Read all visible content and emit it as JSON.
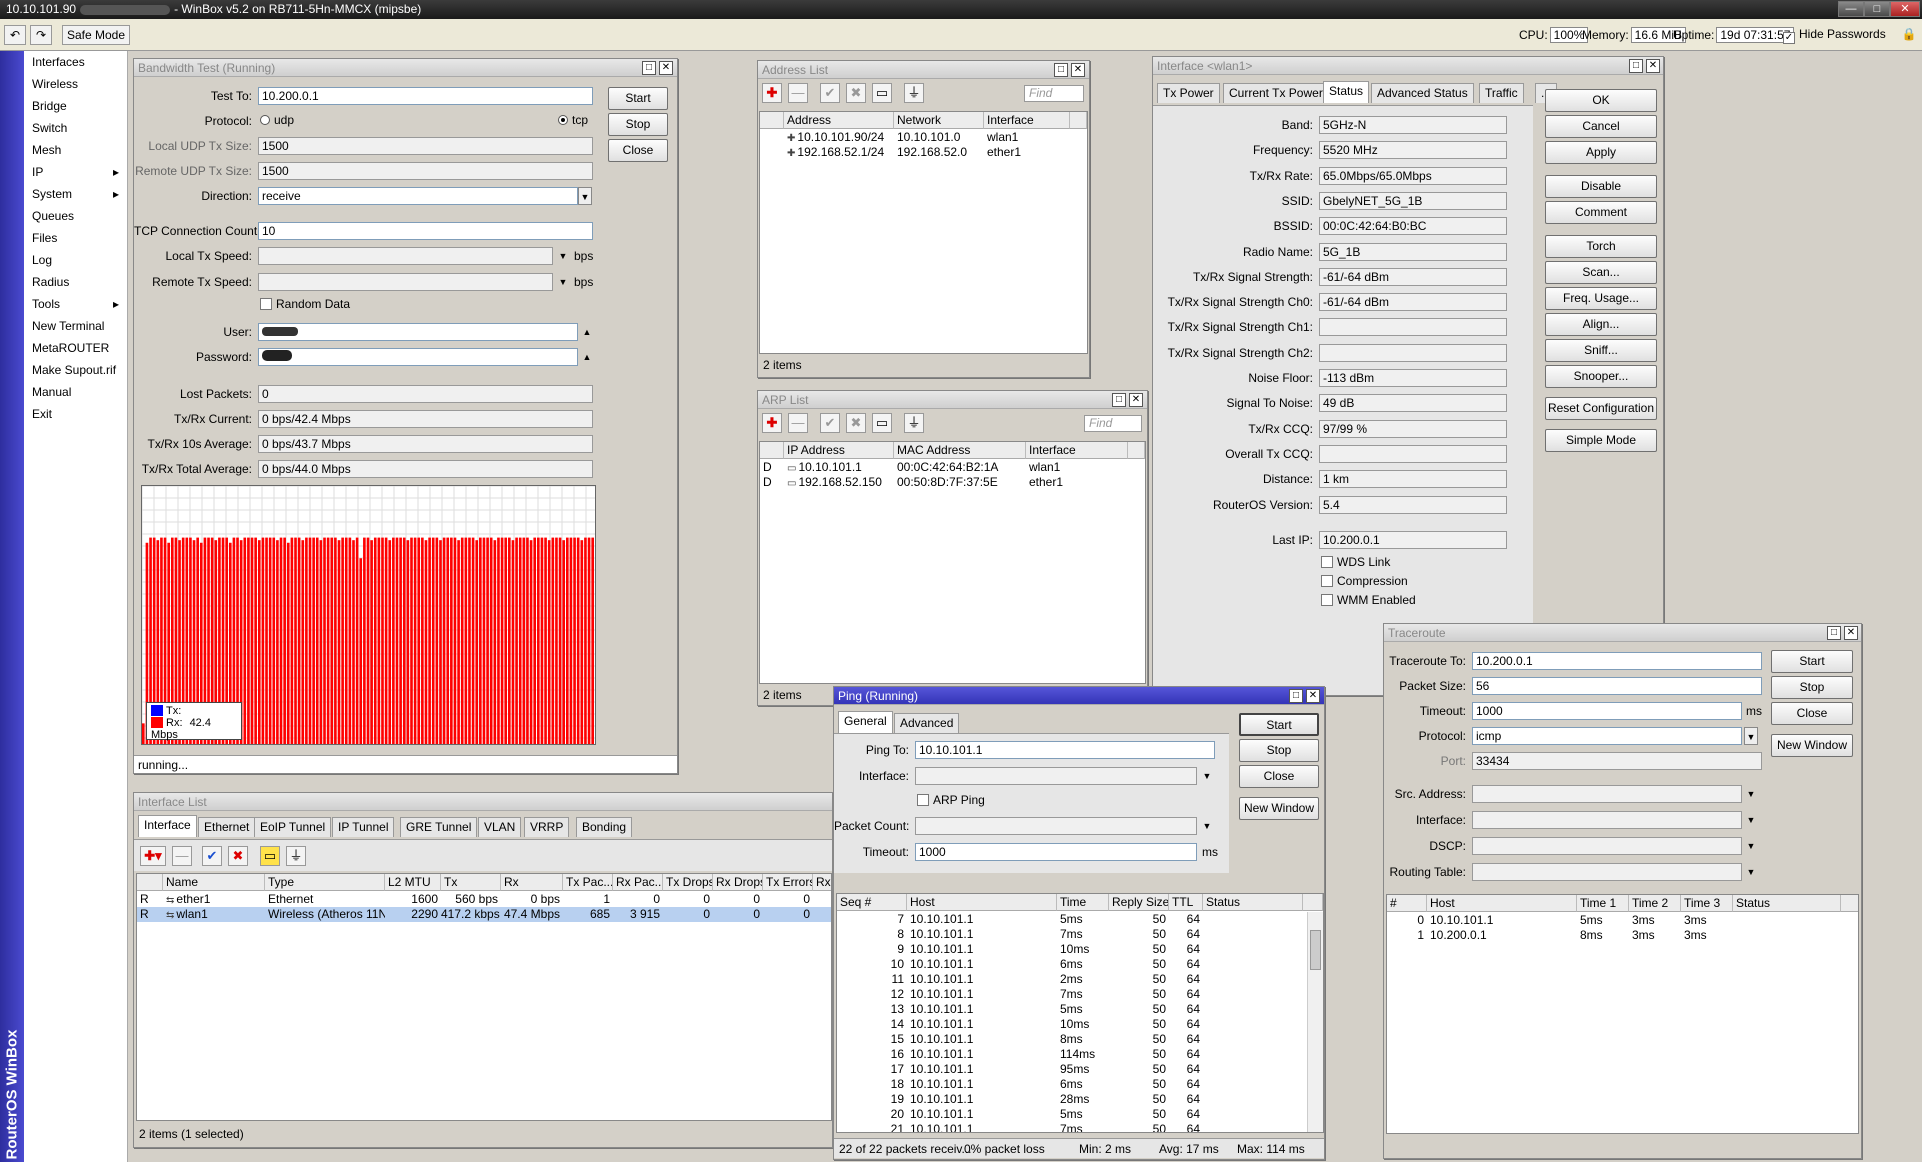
{
  "titlebar": {
    "address": "10.10.101.90",
    "title": "WinBox v5.2 on RB711-5Hn-MMCX (mipsbe)"
  },
  "toolbar": {
    "undo": "↶",
    "redo": "↷",
    "safe_mode": "Safe Mode",
    "cpu_label": "CPU:",
    "cpu": "100%",
    "mem_label": "Memory:",
    "mem": "16.6 MiB",
    "uptime_label": "Uptime:",
    "uptime": "19d 07:31:57",
    "hide_passwords": "Hide Passwords"
  },
  "brand": "RouterOS WinBox",
  "menu": [
    {
      "label": "Interfaces"
    },
    {
      "label": "Wireless"
    },
    {
      "label": "Bridge"
    },
    {
      "label": "Switch"
    },
    {
      "label": "Mesh"
    },
    {
      "label": "IP",
      "arrow": "▸"
    },
    {
      "label": "System",
      "arrow": "▸"
    },
    {
      "label": "Queues"
    },
    {
      "label": "Files"
    },
    {
      "label": "Log"
    },
    {
      "label": "Radius"
    },
    {
      "label": "Tools",
      "arrow": "▸"
    },
    {
      "label": "New Terminal"
    },
    {
      "label": "MetaROUTER"
    },
    {
      "label": "Make Supout.rif"
    },
    {
      "label": "Manual"
    },
    {
      "label": "Exit"
    }
  ],
  "bw": {
    "title": "Bandwidth Test (Running)",
    "test_to_l": "Test To:",
    "test_to": "10.200.0.1",
    "protocol_l": "Protocol:",
    "udp": "udp",
    "tcp": "tcp",
    "ludp_l": "Local UDP Tx Size:",
    "ludp": "1500",
    "rudp_l": "Remote UDP Tx Size:",
    "rudp": "1500",
    "dir_l": "Direction:",
    "dir": "receive",
    "tcpc_l": "TCP Connection Count:",
    "tcpc": "10",
    "ltx_l": "Local Tx Speed:",
    "rtx_l": "Remote Tx Speed:",
    "bps": "bps",
    "random": "Random Data",
    "user_l": "User:",
    "pass_l": "Password:",
    "lost_l": "Lost Packets:",
    "lost": "0",
    "cur_l": "Tx/Rx Current:",
    "cur": "0 bps/42.4 Mbps",
    "avg10_l": "Tx/Rx 10s Average:",
    "avg10": "0 bps/43.7 Mbps",
    "tot_l": "Tx/Rx Total Average:",
    "tot": "0 bps/44.0 Mbps",
    "start": "Start",
    "stop": "Stop",
    "close": "Close",
    "legend_tx": "Tx:",
    "legend_rx": "Rx:",
    "legend_rx_val": "42.4 Mbps",
    "status": "running...",
    "tx_color": "#0000ff",
    "rx_color": "#ff0000"
  },
  "chart_data": {
    "type": "bar",
    "series": [
      {
        "name": "Rx",
        "values": [
          8,
          78,
          80,
          80,
          79,
          80,
          80,
          78,
          80,
          80,
          79,
          80,
          80,
          80,
          79,
          80,
          78,
          80,
          80,
          80,
          79,
          80,
          80,
          80,
          78,
          80,
          80,
          79,
          80,
          80,
          80,
          80,
          79,
          80,
          80,
          80,
          80,
          79,
          80,
          80,
          78,
          80,
          80,
          80,
          79,
          80,
          80,
          80,
          80,
          79,
          80,
          80,
          80,
          80,
          79,
          80,
          80,
          80,
          79,
          80,
          72,
          80,
          80,
          79,
          80,
          80,
          80,
          80,
          79,
          80,
          80,
          80,
          80,
          79,
          80,
          80,
          80,
          80,
          79,
          80,
          80,
          80,
          79,
          80,
          80,
          80,
          80,
          79,
          80,
          80,
          80,
          80,
          79,
          80,
          80,
          80,
          80,
          79,
          80,
          80,
          80,
          80,
          79,
          80,
          80,
          80,
          80,
          79,
          80,
          80,
          80,
          80,
          79,
          80,
          80,
          80,
          79,
          80,
          80,
          80,
          80,
          79,
          80,
          80,
          80
        ]
      }
    ]
  },
  "addr": {
    "title": "Address List",
    "find": "Find",
    "cols": [
      "Address",
      "Network",
      "Interface"
    ],
    "rows": [
      [
        "10.10.101.90/24",
        "10.10.101.0",
        "wlan1"
      ],
      [
        "192.168.52.1/24",
        "192.168.52.0",
        "ether1"
      ]
    ],
    "status": "2 items"
  },
  "arp": {
    "title": "ARP List",
    "find": "Find",
    "cols": [
      "IP Address",
      "MAC Address",
      "Interface"
    ],
    "rows": [
      [
        "D",
        "10.10.101.1",
        "00:0C:42:64:B2:1A",
        "wlan1"
      ],
      [
        "D",
        "192.168.52.150",
        "00:50:8D:7F:37:5E",
        "ether1"
      ]
    ],
    "status": "2 items"
  },
  "iface": {
    "title": "Interface <wlan1>",
    "tabs": [
      "Tx Power",
      "Current Tx Power",
      "Status",
      "Advanced Status",
      "Traffic",
      "..."
    ],
    "fields": [
      [
        "Band:",
        "5GHz-N"
      ],
      [
        "Frequency:",
        "5520 MHz"
      ],
      [
        "Tx/Rx Rate:",
        "65.0Mbps/65.0Mbps"
      ],
      [
        "SSID:",
        "GbelyNET_5G_1B"
      ],
      [
        "BSSID:",
        "00:0C:42:64:B0:BC"
      ],
      [
        "Radio Name:",
        "5G_1B"
      ],
      [
        "Tx/Rx Signal Strength:",
        "-61/-64 dBm"
      ],
      [
        "Tx/Rx Signal Strength Ch0:",
        "-61/-64 dBm"
      ],
      [
        "Tx/Rx Signal Strength Ch1:",
        ""
      ],
      [
        "Tx/Rx Signal Strength Ch2:",
        ""
      ],
      [
        "Noise Floor:",
        "-113 dBm"
      ],
      [
        "Signal To Noise:",
        "49 dB"
      ],
      [
        "Tx/Rx CCQ:",
        "97/99 %"
      ],
      [
        "Overall Tx CCQ:",
        ""
      ],
      [
        "Distance:",
        "1 km"
      ],
      [
        "RouterOS Version:",
        "5.4"
      ]
    ],
    "last_ip_l": "Last IP:",
    "last_ip": "10.200.0.1",
    "wds": "WDS Link",
    "compression": "Compression",
    "wmm": "WMM Enabled",
    "buttons": [
      "OK",
      "Cancel",
      "Apply",
      "Disable",
      "Comment",
      "Torch",
      "Scan...",
      "Freq. Usage...",
      "Align...",
      "Sniff...",
      "Snooper...",
      "Reset Configuration",
      "Simple Mode"
    ]
  },
  "ilist": {
    "title": "Interface List",
    "tabs": [
      "Interface",
      "Ethernet",
      "EoIP Tunnel",
      "IP Tunnel",
      "GRE Tunnel",
      "VLAN",
      "VRRP",
      "Bonding"
    ],
    "cols": [
      "Name",
      "Type",
      "L2 MTU",
      "Tx",
      "Rx",
      "Tx Pac...",
      "Rx Pac...",
      "Tx Drops",
      "Rx Drops",
      "Tx Errors",
      "Rx Er"
    ],
    "rows": [
      [
        "R",
        "ether1",
        "Ethernet",
        "1600",
        "560 bps",
        "0 bps",
        "1",
        "0",
        "0",
        "0",
        "0"
      ],
      [
        "R",
        "wlan1",
        "Wireless (Atheros 11N)",
        "2290",
        "417.2 kbps",
        "47.4 Mbps",
        "685",
        "3 915",
        "0",
        "0",
        "0"
      ]
    ],
    "status": "2 items (1 selected)"
  },
  "ping": {
    "title": "Ping (Running)",
    "tabs": [
      "General",
      "Advanced"
    ],
    "ping_to_l": "Ping To:",
    "ping_to": "10.10.101.1",
    "iface_l": "Interface:",
    "arp": "ARP Ping",
    "pc_l": "Packet Count:",
    "timeout_l": "Timeout:",
    "timeout": "1000",
    "ms": "ms",
    "start": "Start",
    "stop": "Stop",
    "close": "Close",
    "new_window": "New Window",
    "cols": [
      "Seq #",
      "Host",
      "Time",
      "Reply Size",
      "TTL",
      "Status"
    ],
    "rows": [
      [
        "7",
        "10.10.101.1",
        "5ms",
        "50",
        "64"
      ],
      [
        "8",
        "10.10.101.1",
        "7ms",
        "50",
        "64"
      ],
      [
        "9",
        "10.10.101.1",
        "10ms",
        "50",
        "64"
      ],
      [
        "10",
        "10.10.101.1",
        "6ms",
        "50",
        "64"
      ],
      [
        "11",
        "10.10.101.1",
        "2ms",
        "50",
        "64"
      ],
      [
        "12",
        "10.10.101.1",
        "7ms",
        "50",
        "64"
      ],
      [
        "13",
        "10.10.101.1",
        "5ms",
        "50",
        "64"
      ],
      [
        "14",
        "10.10.101.1",
        "10ms",
        "50",
        "64"
      ],
      [
        "15",
        "10.10.101.1",
        "8ms",
        "50",
        "64"
      ],
      [
        "16",
        "10.10.101.1",
        "114ms",
        "50",
        "64"
      ],
      [
        "17",
        "10.10.101.1",
        "95ms",
        "50",
        "64"
      ],
      [
        "18",
        "10.10.101.1",
        "6ms",
        "50",
        "64"
      ],
      [
        "19",
        "10.10.101.1",
        "28ms",
        "50",
        "64"
      ],
      [
        "20",
        "10.10.101.1",
        "5ms",
        "50",
        "64"
      ],
      [
        "21",
        "10.10.101.1",
        "7ms",
        "50",
        "64"
      ]
    ],
    "st1": "22 of 22 packets receiv...",
    "st2": "0% packet loss",
    "st3": "Min: 2 ms",
    "st4": "Avg: 17 ms",
    "st5": "Max: 114 ms"
  },
  "trace": {
    "title": "Traceroute",
    "to_l": "Traceroute To:",
    "to": "10.200.0.1",
    "ps_l": "Packet Size:",
    "ps": "56",
    "to2_l": "Timeout:",
    "to2": "1000",
    "ms": "ms",
    "proto_l": "Protocol:",
    "proto": "icmp",
    "port_l": "Port:",
    "port": "33434",
    "src_l": "Src. Address:",
    "if_l": "Interface:",
    "dscp_l": "DSCP:",
    "rt_l": "Routing Table:",
    "start": "Start",
    "stop": "Stop",
    "close": "Close",
    "new_window": "New Window",
    "cols": [
      "#",
      "Host",
      "Time 1",
      "Time 2",
      "Time 3",
      "Status"
    ],
    "rows": [
      [
        "0",
        "10.10.101.1",
        "5ms",
        "3ms",
        "3ms"
      ],
      [
        "1",
        "10.200.0.1",
        "8ms",
        "3ms",
        "3ms"
      ]
    ]
  }
}
